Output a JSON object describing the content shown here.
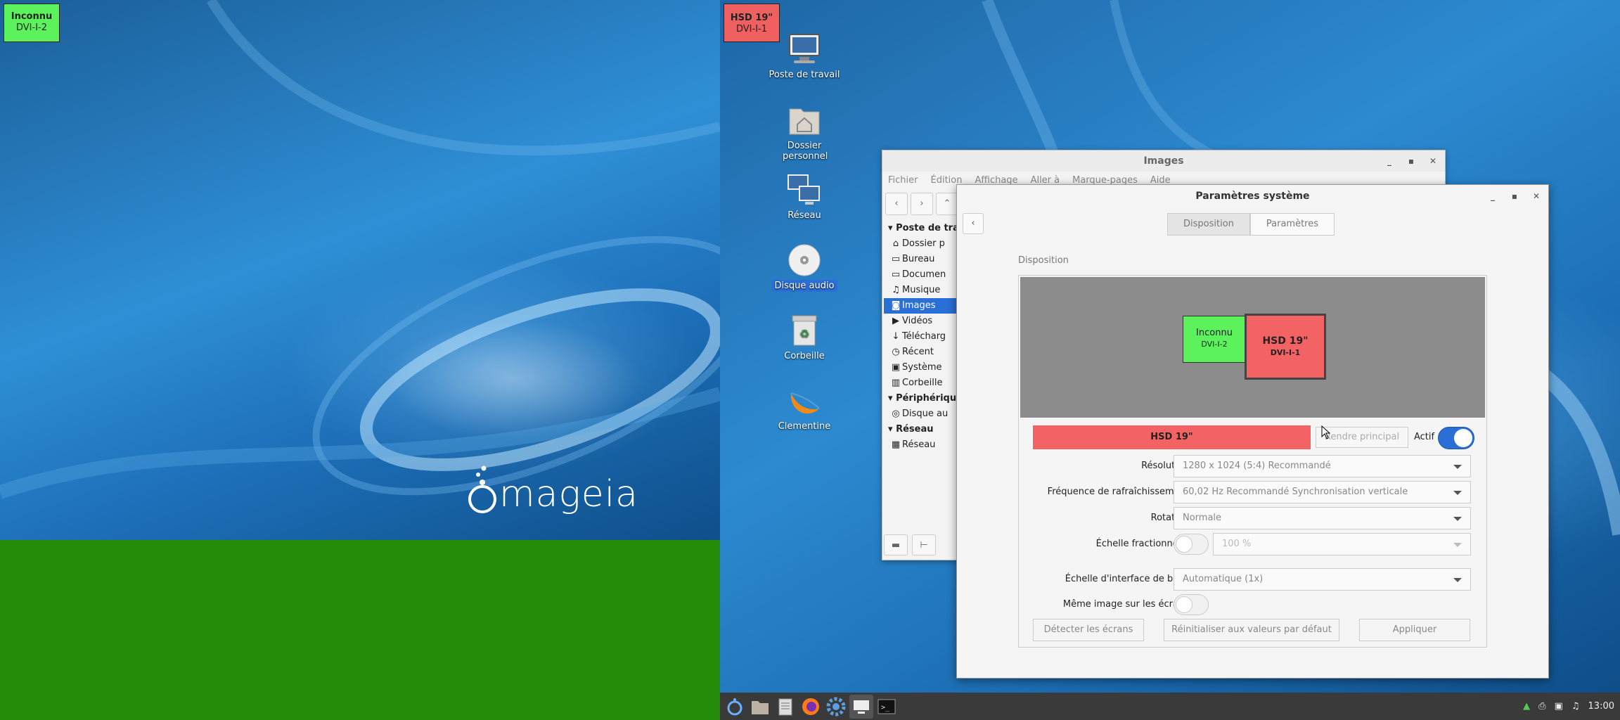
{
  "left_screen": {
    "badge_name": "Inconnu",
    "badge_port": "DVI-I-2",
    "logo_text": "mageia"
  },
  "right_screen": {
    "badge_name": "HSD 19\"",
    "badge_port": "DVI-I-1"
  },
  "desktop_icons": [
    {
      "label": "Poste de travail",
      "icon": "computer-icon"
    },
    {
      "label": "Dossier personnel",
      "icon": "home-folder-icon"
    },
    {
      "label": "Réseau",
      "icon": "network-icon"
    },
    {
      "label": "Disque audio",
      "icon": "cd-icon",
      "selected": true
    },
    {
      "label": "Corbeille",
      "icon": "trash-icon"
    },
    {
      "label": "Clementine",
      "icon": "clementine-icon"
    }
  ],
  "images_window": {
    "title": "Images",
    "menu": [
      "Fichier",
      "Édition",
      "Affichage",
      "Aller à",
      "Marque-pages",
      "Aide"
    ],
    "sidebar": {
      "sections": [
        {
          "title": "Poste de trav",
          "items": [
            {
              "label": "Dossier p",
              "icon": "home-icon"
            },
            {
              "label": "Bureau",
              "icon": "folder-icon"
            },
            {
              "label": "Documen",
              "icon": "folder-icon"
            },
            {
              "label": "Musique",
              "icon": "music-icon"
            },
            {
              "label": "Images",
              "icon": "camera-icon",
              "active": true
            },
            {
              "label": "Vidéos",
              "icon": "video-icon"
            },
            {
              "label": "Télécharg",
              "icon": "download-icon"
            },
            {
              "label": "Récent",
              "icon": "clock-icon"
            },
            {
              "label": "Système",
              "icon": "drive-icon"
            },
            {
              "label": "Corbeille",
              "icon": "trash-icon"
            }
          ]
        },
        {
          "title": "Périphériqu",
          "items": [
            {
              "label": "Disque au",
              "icon": "cd-icon"
            }
          ]
        },
        {
          "title": "Réseau",
          "items": [
            {
              "label": "Réseau",
              "icon": "network-icon"
            }
          ]
        }
      ]
    }
  },
  "params_window": {
    "title": "Paramètres système",
    "tabs": [
      "Disposition",
      "Paramètres"
    ],
    "active_tab": "Disposition",
    "section_heading": "Disposition",
    "monitors": [
      {
        "name": "Inconnu",
        "port": "DVI-I-2",
        "color": "#5cf25c"
      },
      {
        "name": "HSD 19\"",
        "port": "DVI-I-1",
        "color": "#f46363",
        "selected": true
      }
    ],
    "selected_monitor": "HSD 19\"",
    "primary_button": "Rendre principal",
    "active_label": "Actif",
    "active_on": true,
    "resolution_label": "Résolution",
    "resolution_value": "1280 x 1024 (5:4)  Recommandé",
    "refresh_label": "Fréquence de rafraîchissement",
    "refresh_value": "60,02 Hz  Recommandé  Synchronisation verticale",
    "rotation_label": "Rotation",
    "rotation_value": "Normale",
    "fractional_label": "Échelle fractionnelle",
    "fractional_on": false,
    "fractional_value": "100 %",
    "ui_scale_label": "Échelle d'interface de base",
    "ui_scale_value": "Automatique (1x)",
    "mirror_label": "Même image sur les écrans",
    "mirror_on": false,
    "detect_button": "Détecter les écrans",
    "reset_button": "Réinitialiser aux valeurs par défaut",
    "apply_button": "Appliquer"
  },
  "taskbar": {
    "clock": "13:00"
  },
  "colors": {
    "accent": "#2a6fd6",
    "monitor_unknown": "#5cf25c",
    "monitor_hsd": "#f46363"
  }
}
